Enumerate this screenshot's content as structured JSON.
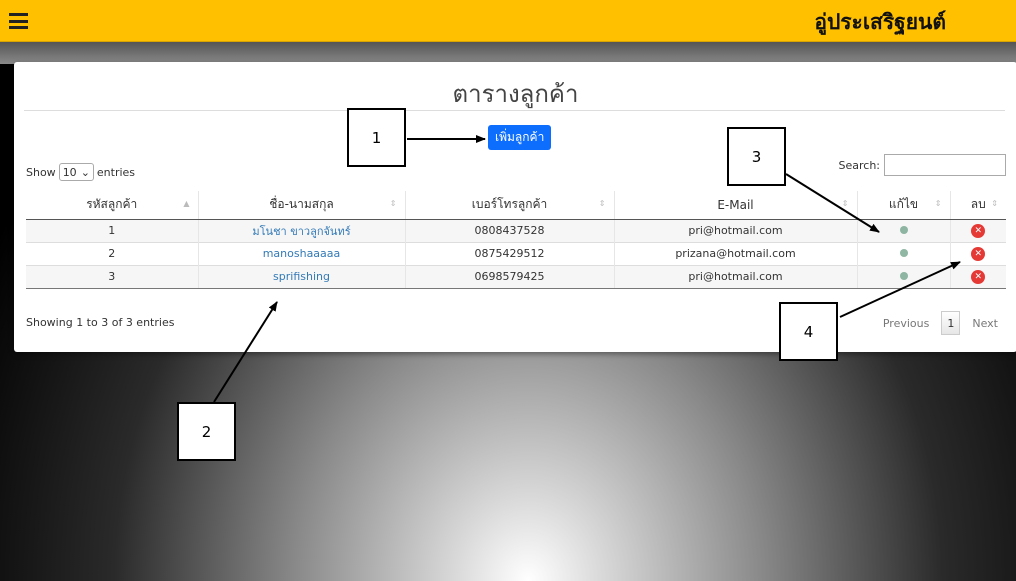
{
  "topbar": {
    "menu_icon": "hamburger-menu-icon",
    "brand": "อู่ประเสริฐยนต์",
    "color": "#ffc000"
  },
  "page": {
    "title": "ตารางลูกค้า",
    "add_button": "เพิ่มลูกค้า"
  },
  "controls": {
    "show_label": "Show",
    "entries_value": "10",
    "entries_label": "entries",
    "search_label": "Search:",
    "search_value": ""
  },
  "table": {
    "headers": [
      "รหัสลูกค้า",
      "ชื่อ-นามสกุล",
      "เบอร์โทรลูกค้า",
      "E-Mail",
      "แก้ไข",
      "ลบ"
    ],
    "rows": [
      {
        "id": "1",
        "name": "มโนชา ขาวลูกจันทร์",
        "phone": "0808437528",
        "email": "pri@hotmail.com"
      },
      {
        "id": "2",
        "name": "manoshaaaaa",
        "phone": "0875429512",
        "email": "prizana@hotmail.com"
      },
      {
        "id": "3",
        "name": "sprifishing",
        "phone": "0698579425",
        "email": "pri@hotmail.com"
      }
    ],
    "edit_icon": "edit-icon",
    "delete_icon": "delete-icon"
  },
  "footer": {
    "info": "Showing 1 to 3 of 3 entries",
    "previous": "Previous",
    "page": "1",
    "next": "Next"
  },
  "callouts": [
    "1",
    "2",
    "3",
    "4"
  ]
}
